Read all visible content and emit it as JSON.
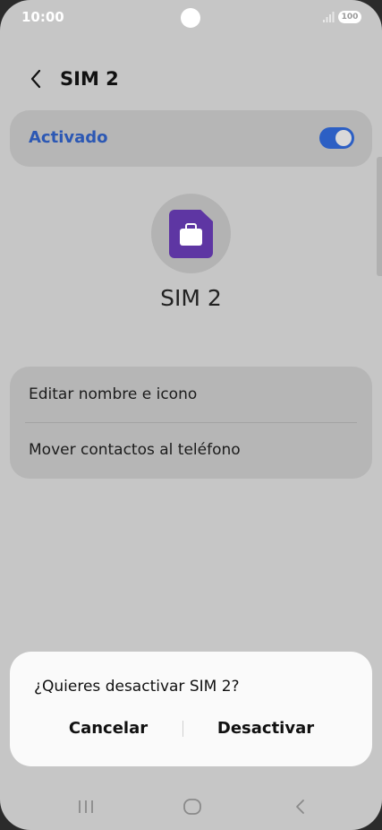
{
  "status_bar": {
    "time": "10:00",
    "battery": "100"
  },
  "header": {
    "title": "SIM 2"
  },
  "toggle": {
    "label": "Activado",
    "state": "on"
  },
  "sim": {
    "name": "SIM 2",
    "icon": "sim-card-work-icon",
    "color": "#5e36a3"
  },
  "options": [
    {
      "label": "Editar nombre e icono"
    },
    {
      "label": "Mover contactos al teléfono"
    }
  ],
  "dialog": {
    "title": "¿Quieres desactivar SIM 2?",
    "cancel_label": "Cancelar",
    "confirm_label": "Desactivar"
  },
  "nav_bar": [
    "recents-icon",
    "home-icon",
    "back-icon"
  ],
  "colors": {
    "accent": "#2c58b4",
    "overlay": "#c6c6c6"
  }
}
